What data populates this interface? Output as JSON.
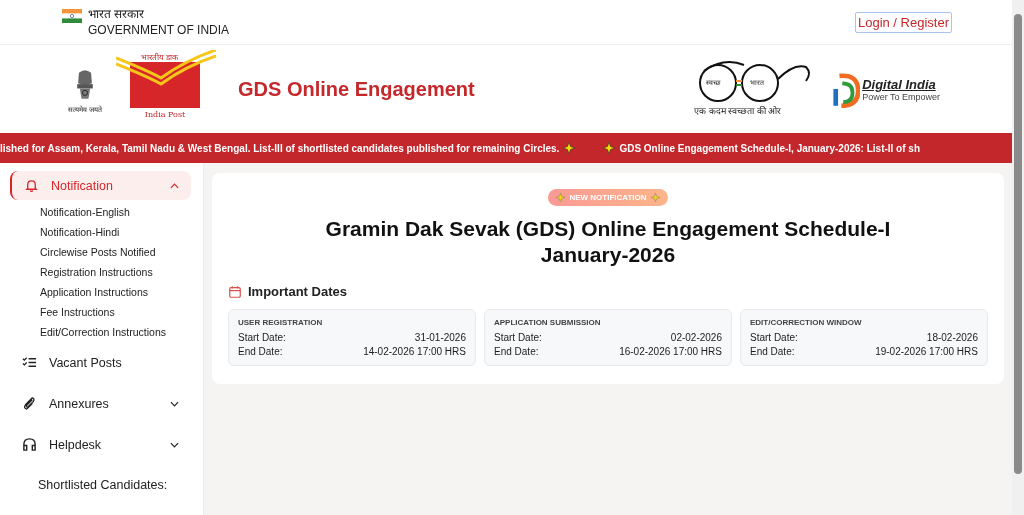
{
  "top_bar": {
    "hindi_title": "भारत सरकार",
    "title": "GOVERNMENT OF INDIA",
    "login_button": "Login / Register"
  },
  "header": {
    "emblem_motto": "सत्यमेव जयते",
    "post_logo_hindi": "भारतीय डाक",
    "post_logo_text": "India Post",
    "site_title": "GDS Online Engagement",
    "swachh_left": "स्वच्छ",
    "swachh_right": "भारत",
    "swachh_tagline": "एक कदम स्वच्छता की ओर",
    "digital_india_title": "Digital India",
    "digital_india_tagline": "Power To Empower"
  },
  "ticker": [
    "lished for Assam, Kerala, Tamil Nadu & West Bengal. List-III of shortlisted candidates published for remaining Circles.",
    "GDS Online Engagement Schedule-I, January-2026: List-II of sh"
  ],
  "sidebar": {
    "items": [
      {
        "label": "Notification",
        "kind": "bell",
        "selected": true,
        "expanded": true,
        "children": [
          {
            "label": "Notification-English"
          },
          {
            "label": "Notification-Hindi"
          },
          {
            "label": "Circlewise Posts Notified"
          },
          {
            "label": "Registration Instructions"
          },
          {
            "label": "Application Instructions"
          },
          {
            "label": "Fee Instructions"
          },
          {
            "label": "Edit/Correction Instructions"
          }
        ]
      },
      {
        "label": "Vacant Posts",
        "kind": "checklist",
        "selected": false
      },
      {
        "label": "Annexures",
        "kind": "paperclip",
        "selected": false,
        "expanded": false
      },
      {
        "label": "Helpdesk",
        "kind": "headset",
        "selected": false,
        "expanded": false
      },
      {
        "label": "Shortlisted Candidates:",
        "kind": "none",
        "selected": false
      }
    ]
  },
  "main": {
    "badge": "NEW NOTIFICATION",
    "title": "Gramin Dak Sevak (GDS) Online Engagement Schedule-I January-2026",
    "dates_heading": "Important Dates",
    "date_cards": [
      {
        "title": "USER REGISTRATION",
        "rows": [
          {
            "label": "Start Date:",
            "value": "31-01-2026"
          },
          {
            "label": "End Date:",
            "value": "14-02-2026 17:00 HRS"
          }
        ]
      },
      {
        "title": "APPLICATION SUBMISSION",
        "rows": [
          {
            "label": "Start Date:",
            "value": "02-02-2026"
          },
          {
            "label": "End Date:",
            "value": "16-02-2026 17:00 HRS"
          }
        ]
      },
      {
        "title": "EDIT/CORRECTION WINDOW",
        "rows": [
          {
            "label": "Start Date:",
            "value": "18-02-2026"
          },
          {
            "label": "End Date:",
            "value": "19-02-2026 17:00 HRS"
          }
        ]
      }
    ]
  }
}
